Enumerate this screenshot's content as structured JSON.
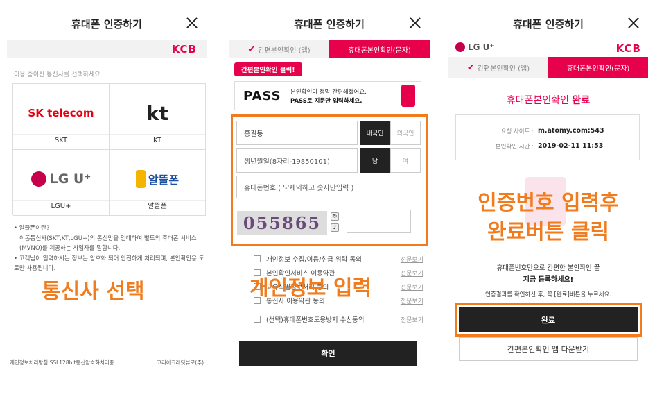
{
  "screen1": {
    "title": "휴대폰 인증하기",
    "brand": "KCB",
    "hint": "이용 중이신 통신사를 선택하세요.",
    "carriers": [
      {
        "logo": "SK telecom",
        "label": "SKT"
      },
      {
        "logo": "kt",
        "label": "KT"
      },
      {
        "logo": "LG U⁺",
        "label": "LGU+"
      },
      {
        "logo": "알뜰폰",
        "label": "알뜰폰"
      }
    ],
    "notes": [
      "• 알뜰폰이란?",
      "이동통신사(SKT,KT,LGU+)의 통신망을 임대하여 별도의 휴대폰 서비스 (MVNO)를 제공하는 사업자를 말합니다.",
      "• 고객님이 입력하시는 정보는 암호화 되어 안전하게 처리되며, 본인확인용 도로만 사용됩니다."
    ],
    "overlay": "통신사 선택",
    "footer_left": "개인정보처리방침  SSL128bit통신암호화처리중",
    "footer_right": "코리아크레딧뷰로(주)"
  },
  "screen2": {
    "title": "휴대폰 인증하기",
    "tab_app": "간편본인확인 (앱)",
    "tab_sms": "휴대폰본인확인(문자)",
    "pill": "간편본인확인 클릭!",
    "pass_logo": "PASS",
    "pass_line1": "본인확인이 정말 간편해졌어요.",
    "pass_line2": "PASS로 지문만 입력하세요.",
    "name_value": "홍길동",
    "nat_local": "내국인",
    "nat_foreign": "외국인",
    "birth_placeholder": "생년월일(8자리-19850101)",
    "gender_m": "남",
    "gender_f": "여",
    "phone_placeholder": "휴대폰번호 ( '-'제외하고 숫자만입력 )",
    "captcha": "055865",
    "agreements": [
      {
        "label": "개인정보 수집/이용/취급 위탁 동의",
        "view": "전문보기"
      },
      {
        "label": "본인확인서비스 이용약관",
        "view": "전문보기"
      },
      {
        "label": "고유식별정보처리 동의",
        "view": "전문보기"
      },
      {
        "label": "통신사 이용약관 동의",
        "view": "전문보기"
      },
      {
        "label": "(선택)휴대폰번호도용방지 수신동의",
        "view": "전문보기"
      }
    ],
    "overlay": "개인정보 입력",
    "confirm": "확인"
  },
  "screen3": {
    "title": "휴대폰 인증하기",
    "carrier_logo": "LG U⁺",
    "brand": "KCB",
    "tab_app": "간편본인확인 (앱)",
    "tab_sms": "휴대폰본인확인(문자)",
    "done_prefix": "휴대폰본인확인 ",
    "done_bold": "완료",
    "site_key": "요청 사이트 :",
    "site_val": "m.atomy.com:543",
    "time_key": "본인확인 시간 :",
    "time_val": "2019-02-11 11:53",
    "overlay_line1": "인증번호 입력후",
    "overlay_line2": "완료버튼 클릭",
    "msg1": "휴대폰번호만으로 간편한 본인확인 끝",
    "msg2": "지금 등록하세요!",
    "msg3": "인증결과를 확인하신 후, 꼭 [완료]버튼을 누르세요.",
    "done_button": "완료",
    "download_button": "간편본인확인 앱 다운받기"
  },
  "colors": {
    "brand": "#e7004c",
    "annotation": "#f07c1e",
    "dark": "#222222"
  }
}
